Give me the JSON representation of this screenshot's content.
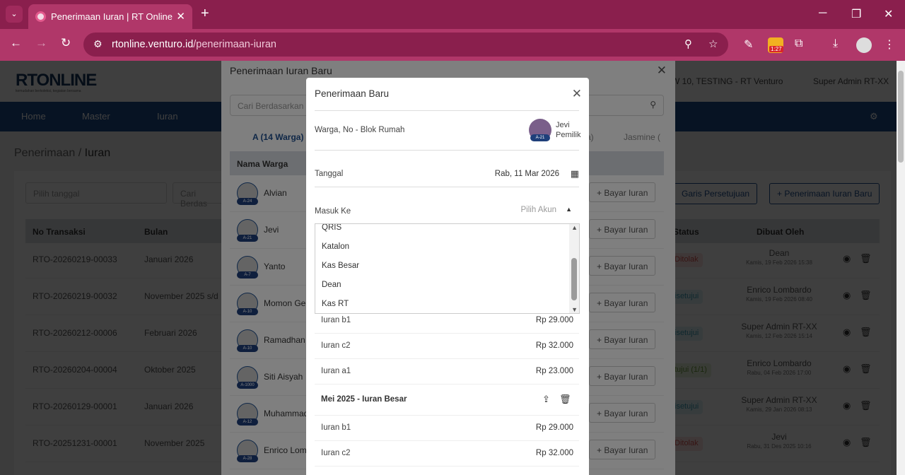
{
  "browser": {
    "tab_title": "Penerimaan Iuran | RT Online",
    "host": "rtonline.venturo.id",
    "path": "/penerimaan-iuran",
    "ext_badge": "1:27"
  },
  "header": {
    "logo": "RTONLINE",
    "tagline": "kemudahan berkoleksi, kegiatan bersama",
    "location": "W 10, TESTING - RT Venturo",
    "user": "Super Admin RT-XX"
  },
  "nav": [
    "Home",
    "Master",
    "Iuran"
  ],
  "breadcrumb": {
    "parent": "Penerimaan",
    "sep": "/",
    "current": "Iuran"
  },
  "filters": {
    "date_placeholder": "Pilih tanggal",
    "search_placeholder": "Cari Berdas"
  },
  "actions": {
    "garis": "Garis Persetujuan",
    "baru": "+ Penerimaan Iuran Baru"
  },
  "table": {
    "headers": [
      "No Transaksi",
      "Bulan",
      "Status",
      "Dibuat Oleh"
    ],
    "rows": [
      {
        "no": "RTO-20260219-00033",
        "bulan": "Januari 2026",
        "status": "Ditolak",
        "by": "Dean",
        "date": "Kamis, 19 Feb 2026 15:38"
      },
      {
        "no": "RTO-20260219-00032",
        "bulan": "November 2025 s/d F",
        "status": "isetujui",
        "by": "Enrico Lombardo",
        "date": "Kamis, 19 Feb 2026 08:40"
      },
      {
        "no": "RTO-20260212-00006",
        "bulan": "Februari 2026",
        "status": "isetujui",
        "by": "Super Admin RT-XX",
        "date": "Kamis, 12 Feb 2026 15:14"
      },
      {
        "no": "RTO-20260204-00004",
        "bulan": "Oktober 2025",
        "status": "tujui (1/1)",
        "by": "Enrico Lombardo",
        "date": "Rabu, 04 Feb 2026 17:00"
      },
      {
        "no": "RTO-20260129-00001",
        "bulan": "Januari 2026",
        "status": "isetujui",
        "by": "Super Admin RT-XX",
        "date": "Kamis, 29 Jan 2026 08:13"
      },
      {
        "no": "RTO-20251231-00001",
        "bulan": "November 2025",
        "status": "Ditolak",
        "by": "Jevi",
        "date": "Rabu, 31 Des 2025 10:16"
      }
    ]
  },
  "modal1": {
    "title": "Penerimaan Iuran Baru",
    "search": "Cari Berdasarkan N",
    "tabs": [
      "A (14 Warga)",
      "a)",
      "Jasmine ("
    ],
    "col": "Nama Warga",
    "bayar": "+ Bayar Iuran",
    "warga": [
      {
        "name": "Alvian",
        "tag": "A-24"
      },
      {
        "name": "Jevi",
        "tag": "A-21"
      },
      {
        "name": "Yanto",
        "tag": "A-7"
      },
      {
        "name": "Momon Gei",
        "tag": "A-10"
      },
      {
        "name": "Ramadhan",
        "tag": "A-10"
      },
      {
        "name": "Siti Aisyah",
        "tag": "A-1000"
      },
      {
        "name": "Muhammad",
        "tag": "A-12"
      },
      {
        "name": "Enrico Lomb",
        "tag": "A-28"
      }
    ]
  },
  "modal2": {
    "title": "Penerimaan Baru",
    "warga_label": "Warga, No - Blok Rumah",
    "warga_name": "Jevi",
    "warga_role": "Pemilik",
    "warga_tag": "A-21",
    "tanggal_label": "Tanggal",
    "tanggal_value": "Rab, 11 Mar 2026",
    "masuk_label": "Masuk Ke",
    "masuk_placeholder": "Pilih Akun",
    "options": [
      "QRIS",
      "Katalon",
      "Kas Besar",
      "Dean",
      "Kas RT"
    ],
    "items1": [
      {
        "n": "Iuran b1",
        "p": "Rp 29.000"
      },
      {
        "n": "Iuran c2",
        "p": "Rp 32.000"
      },
      {
        "n": "Iuran a1",
        "p": "Rp 23.000"
      }
    ],
    "group": "Mei 2025 - Iuran Besar",
    "items2": [
      {
        "n": "Iuran b1",
        "p": "Rp 29.000"
      },
      {
        "n": "Iuran c2",
        "p": "Rp 32.000"
      }
    ]
  }
}
